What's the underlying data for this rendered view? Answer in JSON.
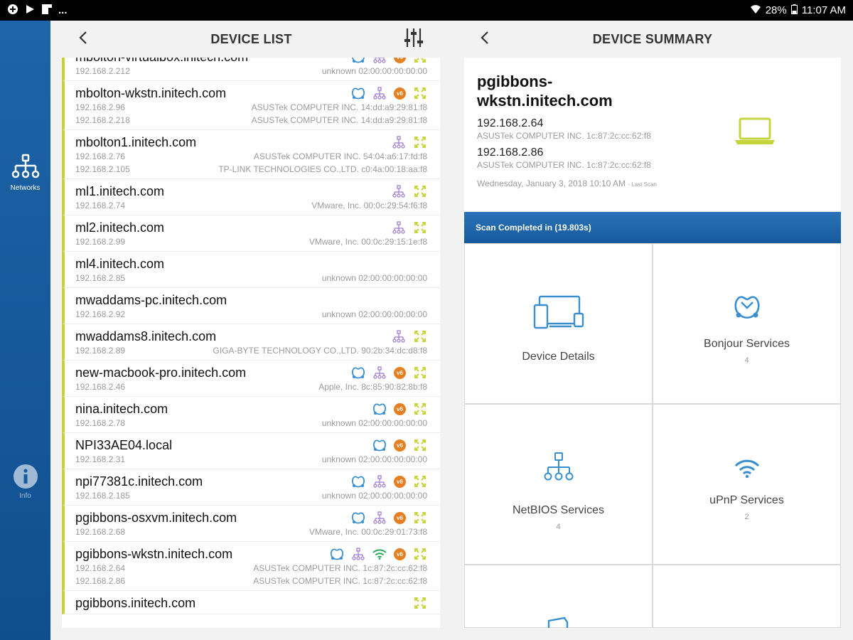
{
  "status_bar": {
    "battery": "28%",
    "time": "11:07 AM",
    "more": "..."
  },
  "sidebar": {
    "items": [
      {
        "label": "Networks",
        "icon": "network-icon"
      },
      {
        "label": "Info",
        "icon": "info-icon"
      }
    ]
  },
  "device_list": {
    "title": "DEVICE LIST",
    "devices": [
      {
        "name": "mbolton-virtualbox.initech.com",
        "addresses": [
          {
            "ip": "192.168.2.212",
            "vendor_mac": "unknown 02:00:00:00:00:00"
          }
        ],
        "icons": [
          "bonjour",
          "netbios",
          "v6",
          "upnp"
        ]
      },
      {
        "name": "mbolton-wkstn.initech.com",
        "addresses": [
          {
            "ip": "192.168.2.96",
            "vendor_mac": "ASUSTek COMPUTER INC. 14:dd:a9:29:81:f8"
          },
          {
            "ip": "192.168.2.218",
            "vendor_mac": "ASUSTek COMPUTER INC. 14:dd:a9:29:81:f8"
          }
        ],
        "icons": [
          "bonjour",
          "netbios",
          "v6",
          "upnp"
        ]
      },
      {
        "name": "mbolton1.initech.com",
        "addresses": [
          {
            "ip": "192.168.2.76",
            "vendor_mac": "ASUSTek COMPUTER INC. 54:04:a6:17:fd:f8"
          },
          {
            "ip": "192.168.2.105",
            "vendor_mac": "TP-LINK TECHNOLOGIES CO.,LTD. c0:4a:00:18:aa:f8"
          }
        ],
        "icons": [
          "netbios",
          "upnp"
        ]
      },
      {
        "name": "ml1.initech.com",
        "addresses": [
          {
            "ip": "192.168.2.74",
            "vendor_mac": "VMware, Inc. 00:0c:29:54:f6:f8"
          }
        ],
        "icons": [
          "netbios",
          "upnp"
        ]
      },
      {
        "name": "ml2.initech.com",
        "addresses": [
          {
            "ip": "192.168.2.99",
            "vendor_mac": "VMware, Inc. 00:0c:29:15:1e:f8"
          }
        ],
        "icons": [
          "netbios",
          "upnp"
        ]
      },
      {
        "name": "ml4.initech.com",
        "addresses": [
          {
            "ip": "192.168.2.85",
            "vendor_mac": "unknown 02:00:00:00:00:00"
          }
        ],
        "icons": []
      },
      {
        "name": "mwaddams-pc.initech.com",
        "addresses": [
          {
            "ip": "192.168.2.92",
            "vendor_mac": "unknown 02:00:00:00:00:00"
          }
        ],
        "icons": []
      },
      {
        "name": "mwaddams8.initech.com",
        "addresses": [
          {
            "ip": "192.168.2.89",
            "vendor_mac": "GIGA-BYTE TECHNOLOGY CO.,LTD. 90:2b:34:dc:d8:f8"
          }
        ],
        "icons": [
          "netbios",
          "upnp"
        ]
      },
      {
        "name": "new-macbook-pro.initech.com",
        "addresses": [
          {
            "ip": "192.168.2.46",
            "vendor_mac": "Apple, Inc. 8c:85:90:82:8b:f8"
          }
        ],
        "icons": [
          "bonjour",
          "netbios",
          "v6",
          "upnp"
        ]
      },
      {
        "name": "nina.initech.com",
        "addresses": [
          {
            "ip": "192.168.2.78",
            "vendor_mac": "unknown 02:00:00:00:00:00"
          }
        ],
        "icons": [
          "bonjour",
          "v6",
          "upnp"
        ]
      },
      {
        "name": "NPI33AE04.local",
        "addresses": [
          {
            "ip": "192.168.2.31",
            "vendor_mac": "unknown 02:00:00:00:00:00"
          }
        ],
        "icons": [
          "bonjour",
          "v6",
          "upnp"
        ]
      },
      {
        "name": "npi77381c.initech.com",
        "addresses": [
          {
            "ip": "192.168.2.185",
            "vendor_mac": "unknown 02:00:00:00:00:00"
          }
        ],
        "icons": [
          "bonjour",
          "netbios",
          "v6",
          "upnp"
        ]
      },
      {
        "name": "pgibbons-osxvm.initech.com",
        "addresses": [
          {
            "ip": "192.168.2.68",
            "vendor_mac": "VMware, Inc. 00:0c:29:01:73:f8"
          }
        ],
        "icons": [
          "bonjour",
          "netbios",
          "v6",
          "upnp"
        ]
      },
      {
        "name": "pgibbons-wkstn.initech.com",
        "addresses": [
          {
            "ip": "192.168.2.64",
            "vendor_mac": "ASUSTek COMPUTER INC. 1c:87:2c:cc:62:f8"
          },
          {
            "ip": "192.168.2.86",
            "vendor_mac": "ASUSTek COMPUTER INC. 1c:87:2c:cc:62:f8"
          }
        ],
        "icons": [
          "bonjour",
          "netbios",
          "wifi",
          "v6",
          "upnp"
        ]
      },
      {
        "name": "pgibbons.initech.com",
        "addresses": [],
        "icons": [
          "upnp"
        ]
      }
    ]
  },
  "summary": {
    "title": "DEVICE SUMMARY",
    "device_name": "pgibbons-wkstn.initech.com",
    "ip1": "192.168.2.64",
    "vendor1": "ASUSTek COMPUTER INC. 1c:87:2c:cc:62:f8",
    "ip2": "192.168.2.86",
    "vendor2": "ASUSTek COMPUTER INC. 1c:87:2c:cc:62:f8",
    "date": "Wednesday, January 3, 2018 10:10 AM",
    "date_suffix": "- Last Scan",
    "scan_status": "Scan Completed in (19.803s)",
    "tiles": [
      {
        "label": "Device Details",
        "count": ""
      },
      {
        "label": "Bonjour Services",
        "count": "4"
      },
      {
        "label": "NetBIOS Services",
        "count": "4"
      },
      {
        "label": "uPnP Services",
        "count": "2"
      }
    ]
  },
  "colors": {
    "accent_bar": "#c6d43c",
    "sidebar_blue": "#1a5fa3",
    "bonjour": "#3a8fd1",
    "netbios": "#a887d6",
    "v6": "#e67e22",
    "upnp": "#c8d43a",
    "wifi": "#2eaa5a"
  }
}
